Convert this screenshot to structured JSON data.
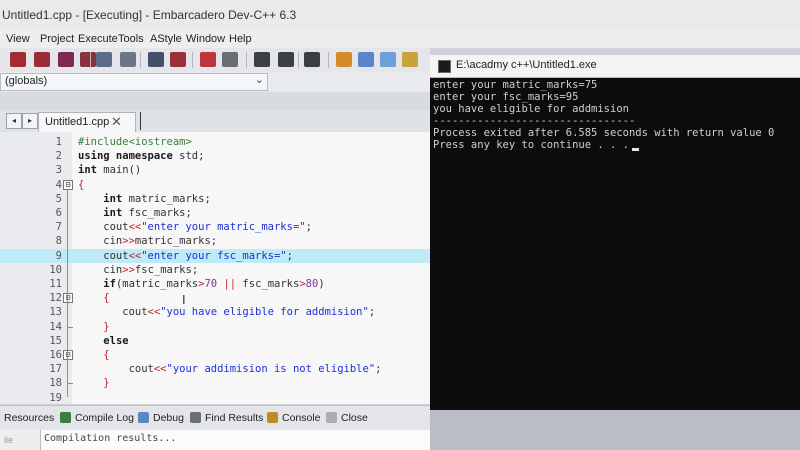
{
  "window": {
    "title": "Untitled1.cpp - [Executing] - Embarcadero Dev-C++ 6.3"
  },
  "menu": [
    "View",
    "Project",
    "Execute",
    "Tools",
    "AStyle",
    "Window",
    "Help"
  ],
  "scope": {
    "value": "(globals)",
    "arrow": "⌄"
  },
  "tab": {
    "filename": "Untitled1.cpp",
    "close": "✕",
    "prev": "◂",
    "next": "▸"
  },
  "editor": {
    "highlighted_line": 9,
    "lines": [
      {
        "n": "1",
        "fold": "",
        "segs": [
          [
            "pp",
            "#include<iostream>"
          ]
        ]
      },
      {
        "n": "2",
        "fold": "",
        "segs": [
          [
            "kw",
            "using namespace "
          ],
          [
            "plain",
            "std;"
          ]
        ]
      },
      {
        "n": "3",
        "fold": "",
        "segs": [
          [
            "kw",
            "int "
          ],
          [
            "plain",
            "main()"
          ]
        ]
      },
      {
        "n": "4",
        "fold": "⊟",
        "segs": [
          [
            "op",
            "{"
          ]
        ]
      },
      {
        "n": "5",
        "fold": "",
        "segs": [
          [
            "plain",
            "    "
          ],
          [
            "kw",
            "int "
          ],
          [
            "plain",
            "matric_marks;"
          ]
        ]
      },
      {
        "n": "6",
        "fold": "",
        "segs": [
          [
            "plain",
            "    "
          ],
          [
            "kw",
            "int "
          ],
          [
            "plain",
            "fsc_marks;"
          ]
        ]
      },
      {
        "n": "7",
        "fold": "",
        "segs": [
          [
            "plain",
            "    cout"
          ],
          [
            "op",
            "<<"
          ],
          [
            "str",
            "\"enter your matric_marks=\""
          ],
          [
            "plain",
            ";"
          ]
        ]
      },
      {
        "n": "8",
        "fold": "",
        "segs": [
          [
            "plain",
            "    cin"
          ],
          [
            "op",
            ">>"
          ],
          [
            "plain",
            "matric_marks;"
          ]
        ]
      },
      {
        "n": "9",
        "fold": "",
        "segs": [
          [
            "plain",
            "    cout"
          ],
          [
            "op",
            "<<"
          ],
          [
            "str",
            "\"enter your fsc_marks=\""
          ],
          [
            "plain",
            ";"
          ]
        ]
      },
      {
        "n": "10",
        "fold": "",
        "segs": [
          [
            "plain",
            "    cin"
          ],
          [
            "op",
            ">>"
          ],
          [
            "plain",
            "fsc_marks;"
          ]
        ]
      },
      {
        "n": "11",
        "fold": "",
        "segs": [
          [
            "plain",
            "    "
          ],
          [
            "kw",
            "if"
          ],
          [
            "plain",
            "(matric_marks"
          ],
          [
            "op",
            ">"
          ],
          [
            "num",
            "70"
          ],
          [
            "plain",
            " "
          ],
          [
            "op",
            "||"
          ],
          [
            "plain",
            " fsc_marks"
          ],
          [
            "op",
            ">"
          ],
          [
            "num",
            "80"
          ],
          [
            "plain",
            ")"
          ]
        ]
      },
      {
        "n": "12",
        "fold": "⊟",
        "segs": [
          [
            "plain",
            "    "
          ],
          [
            "op",
            "{"
          ]
        ]
      },
      {
        "n": "13",
        "fold": "",
        "segs": [
          [
            "plain",
            "       cout"
          ],
          [
            "op",
            "<<"
          ],
          [
            "str",
            "\"you have eligible for addmision\""
          ],
          [
            "plain",
            ";"
          ]
        ]
      },
      {
        "n": "14",
        "fold": "",
        "segs": [
          [
            "plain",
            "    "
          ],
          [
            "op",
            "}"
          ]
        ]
      },
      {
        "n": "15",
        "fold": "",
        "segs": [
          [
            "plain",
            "    "
          ],
          [
            "kw",
            "else"
          ]
        ]
      },
      {
        "n": "16",
        "fold": "⊟",
        "segs": [
          [
            "plain",
            "    "
          ],
          [
            "op",
            "{"
          ]
        ]
      },
      {
        "n": "17",
        "fold": "",
        "segs": [
          [
            "plain",
            "        cout"
          ],
          [
            "op",
            "<<"
          ],
          [
            "str",
            "\"your addimision is not eligible\""
          ],
          [
            "plain",
            ";"
          ]
        ]
      },
      {
        "n": "18",
        "fold": "",
        "segs": [
          [
            "plain",
            "    "
          ],
          [
            "op",
            "}"
          ]
        ]
      },
      {
        "n": "19",
        "fold": "",
        "segs": []
      }
    ]
  },
  "bottom_tabs": [
    "Resources",
    "Compile Log",
    "Debug",
    "Find Results",
    "Console",
    "Close"
  ],
  "compile_log": {
    "text": "Compilation results...",
    "side": "ile"
  },
  "console": {
    "title": "E:\\acadmy c++\\Untitled1.exe",
    "lines": [
      "enter your matric_marks=75",
      "enter your fsc_marks=95",
      "you have eligible for addmision",
      "--------------------------------",
      "Process exited after 6.585 seconds with return value 0",
      "Press any key to continue . . ."
    ]
  },
  "colors": {
    "highlight_line": "#bfeaf7",
    "string": "#1d2fd6",
    "operator": "#c0262b",
    "console_bg": "#0c0c0c"
  }
}
